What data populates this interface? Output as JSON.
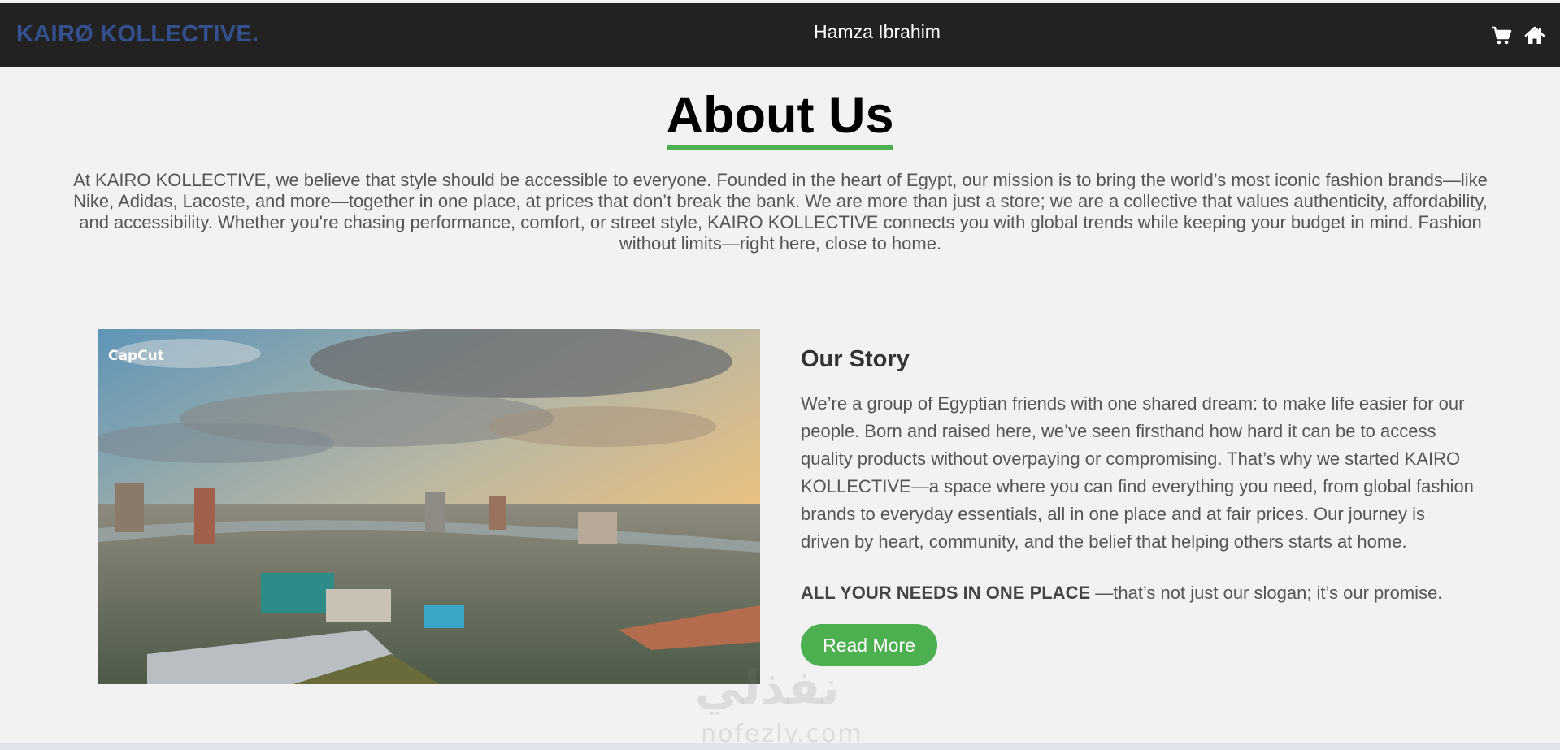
{
  "header": {
    "brand": "KAIRØ KOLLECTIVE.",
    "user_name": "Hamza Ibrahim",
    "icons": [
      "cart-icon",
      "home-icon"
    ]
  },
  "about": {
    "title": "About Us",
    "intro": "At KAIRO KOLLECTIVE, we believe that style should be accessible to everyone. Founded in the heart of Egypt, our mission is to bring the world’s most iconic fashion brands—like Nike, Adidas, Lacoste, and more—together in one place, at prices that don’t break the bank. We are more than just a store; we are a collective that values authenticity, affordability, and accessibility. Whether you're chasing performance, comfort, or street style, KAIRO KOLLECTIVE connects you with global trends while keeping your budget in mind. Fashion without limits—right here, close to home."
  },
  "story": {
    "image_label": "CapCut",
    "title": "Our Story",
    "text": "We’re a group of Egyptian friends with one shared dream: to make life easier for our people. Born and raised here, we’ve seen firsthand how hard it can be to access quality products without overpaying or compromising. That’s why we started KAIRO KOLLECTIVE—a space where you can find everything you need, from global fashion brands to everyday essentials, all in one place and at fair prices. Our journey is driven by heart, community, and the belief that helping others starts at home.",
    "slogan_bold": "ALL YOUR NEEDS IN ONE PLACE",
    "slogan_rest": " —that’s not just our slogan; it’s our promise.",
    "button_label": "Read More"
  },
  "watermark": {
    "arabic": "نفذلي",
    "latin": "nofezly.com"
  },
  "colors": {
    "header_bg": "#222222",
    "brand": "#34508f",
    "accent": "#4caf50",
    "page_bg": "#f2f2f2",
    "body_text": "#555555"
  }
}
